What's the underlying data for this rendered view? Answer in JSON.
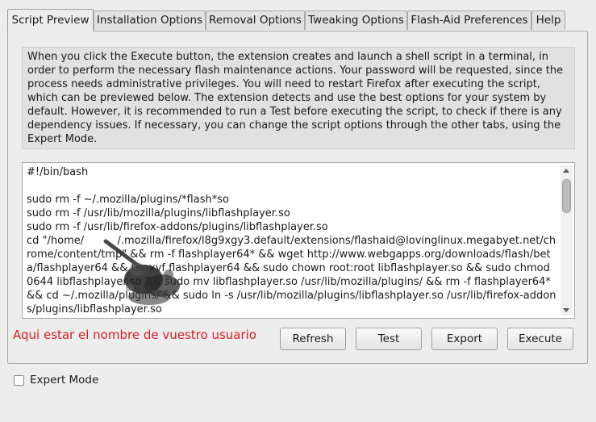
{
  "tabs": [
    {
      "label": "Script Preview",
      "active": true
    },
    {
      "label": "Installation Options",
      "active": false
    },
    {
      "label": "Removal Options",
      "active": false
    },
    {
      "label": "Tweaking Options",
      "active": false
    },
    {
      "label": "Flash-Aid Preferences",
      "active": false
    },
    {
      "label": "Help",
      "active": false
    }
  ],
  "description": "When you click the Execute button, the extension creates and launch a shell script in a terminal, in order to perform the necessary flash maintenance actions. Your password will be requested, since the process needs administrative privileges. You will need to restart Firefox after executing the script, which can be previewed below. The extension detects and use the best options for your system by default. However, it is recommended to run a Test before executing the script, to check if there is any dependency issues. If necessary, you can change the script options through the other tabs, using the Expert Mode.",
  "script": "#!/bin/bash\n\nsudo rm -f ~/.mozilla/plugins/*flash*so\nsudo rm -f /usr/lib/mozilla/plugins/libflashplayer.so\nsudo rm -f /usr/lib/firefox-addons/plugins/libflashplayer.so\ncd \"/home/          /.mozilla/firefox/l8g9xgy3.default/extensions/flashaid@lovinglinux.megabyet.net/chrome/content/tmp\" && rm -f flashplayer64* && wget http://www.webgapps.org/downloads/flash/beta/flashplayer64 && tar xvf flashplayer64 && sudo chown root:root libflashplayer.so && sudo chmod 0644 libflashplayer.so && sudo mv libflashplayer.so /usr/lib/mozilla/plugins/ && rm -f flashplayer64* && cd ~/.mozilla/plugins/ && sudo ln -s /usr/lib/mozilla/plugins/libflashplayer.so /usr/lib/firefox-addons/plugins/libflashplayer.so",
  "annotation": "Aqui estar el nombre de vuestro usuario",
  "buttons": {
    "refresh": "Refresh",
    "test": "Test",
    "export": "Export",
    "execute": "Execute"
  },
  "expert_mode": {
    "label": "Expert Mode",
    "checked": false
  },
  "colors": {
    "annotation": "#d62020",
    "background": "#ededed"
  }
}
